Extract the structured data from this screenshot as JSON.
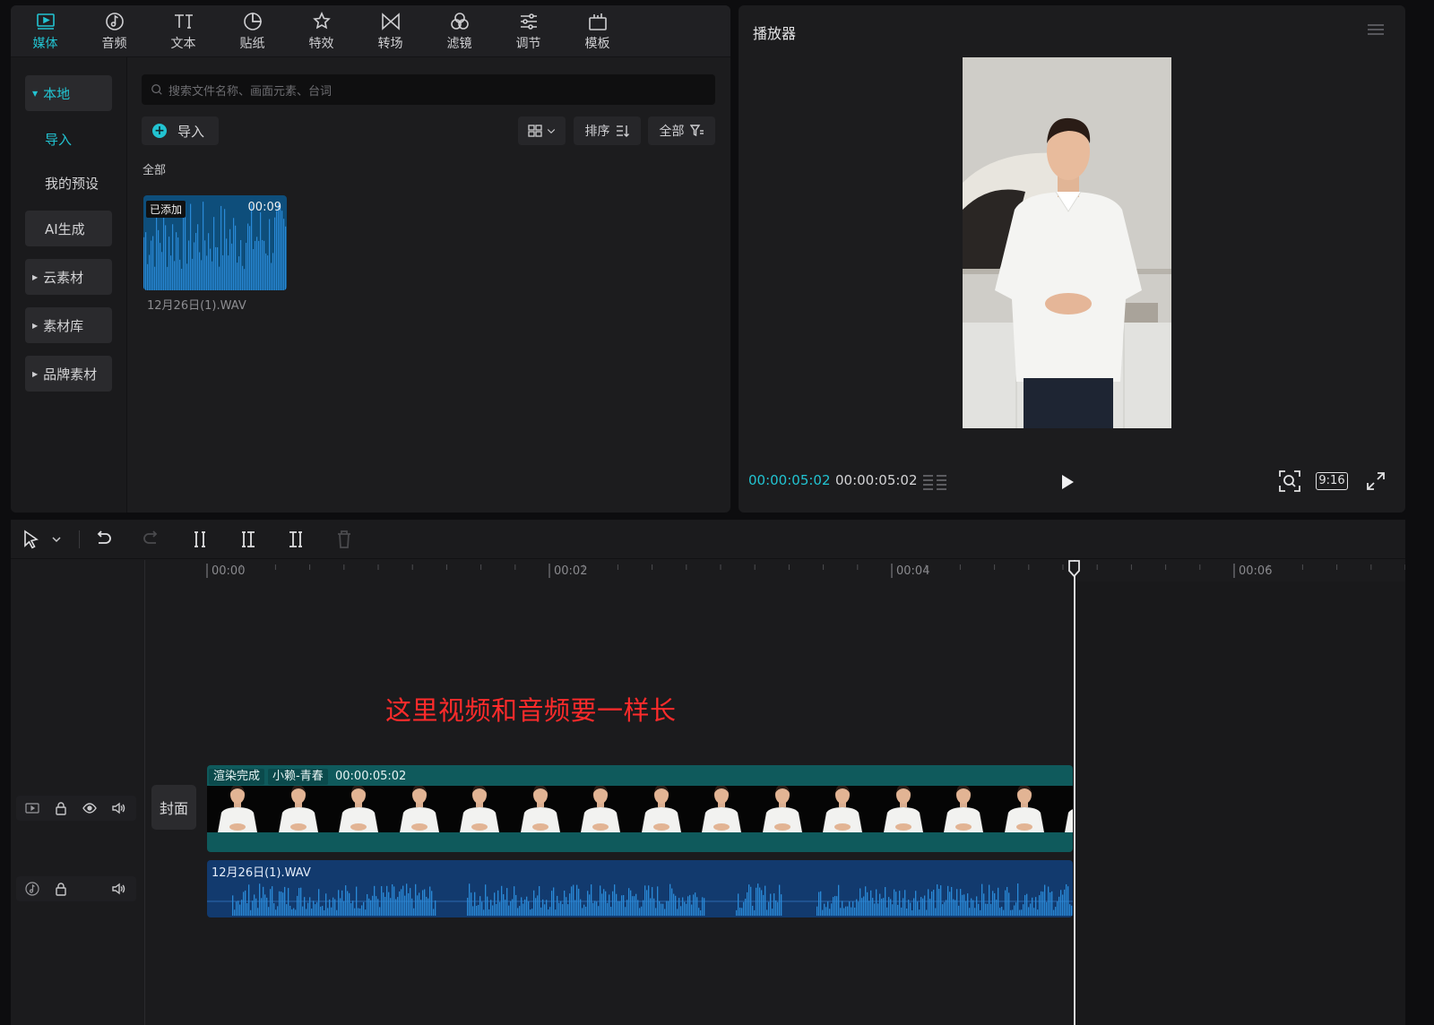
{
  "tabs": [
    {
      "id": "media",
      "label": "媒体",
      "icon": "media-icon",
      "active": true
    },
    {
      "id": "audio",
      "label": "音频",
      "icon": "music-note-icon"
    },
    {
      "id": "text",
      "label": "文本",
      "icon": "text-icon"
    },
    {
      "id": "sticker",
      "label": "贴纸",
      "icon": "sticker-icon"
    },
    {
      "id": "effects",
      "label": "特效",
      "icon": "effects-star-icon"
    },
    {
      "id": "transition",
      "label": "转场",
      "icon": "transition-icon"
    },
    {
      "id": "filter",
      "label": "滤镜",
      "icon": "filter-icon"
    },
    {
      "id": "adjust",
      "label": "调节",
      "icon": "adjust-sliders-icon"
    },
    {
      "id": "template",
      "label": "模板",
      "icon": "template-icon"
    }
  ],
  "sidebar": {
    "local": "本地",
    "import": "导入",
    "presets": "我的预设",
    "ai": "AI生成",
    "cloud": "云素材",
    "library": "素材库",
    "brand": "品牌素材"
  },
  "media": {
    "search_placeholder": "搜索文件名称、画面元素、台词",
    "import_label": "导入",
    "sort_label": "排序",
    "filter_label": "全部",
    "section_label": "全部",
    "item": {
      "badge": "已添加",
      "duration": "00:09",
      "name": "12月26日(1).WAV"
    }
  },
  "player": {
    "title": "播放器",
    "current_time": "00:00:05:02",
    "total_time": "00:00:05:02",
    "ratio": "9:16"
  },
  "timeline": {
    "ruler": [
      "00:00",
      "00:02",
      "00:04",
      "00:06"
    ],
    "annotation": "这里视频和音频要一样长",
    "cover_label": "封面",
    "video_clip": {
      "status": "渲染完成",
      "name": "小赖-青春",
      "duration": "00:00:05:02"
    },
    "audio_clip": {
      "name": "12月26日(1).WAV"
    }
  },
  "colors": {
    "accent": "#22c3d1",
    "video_clip": "#0f5a5c",
    "audio_clip": "#123a6e",
    "annotation": "#ff2b2b"
  }
}
